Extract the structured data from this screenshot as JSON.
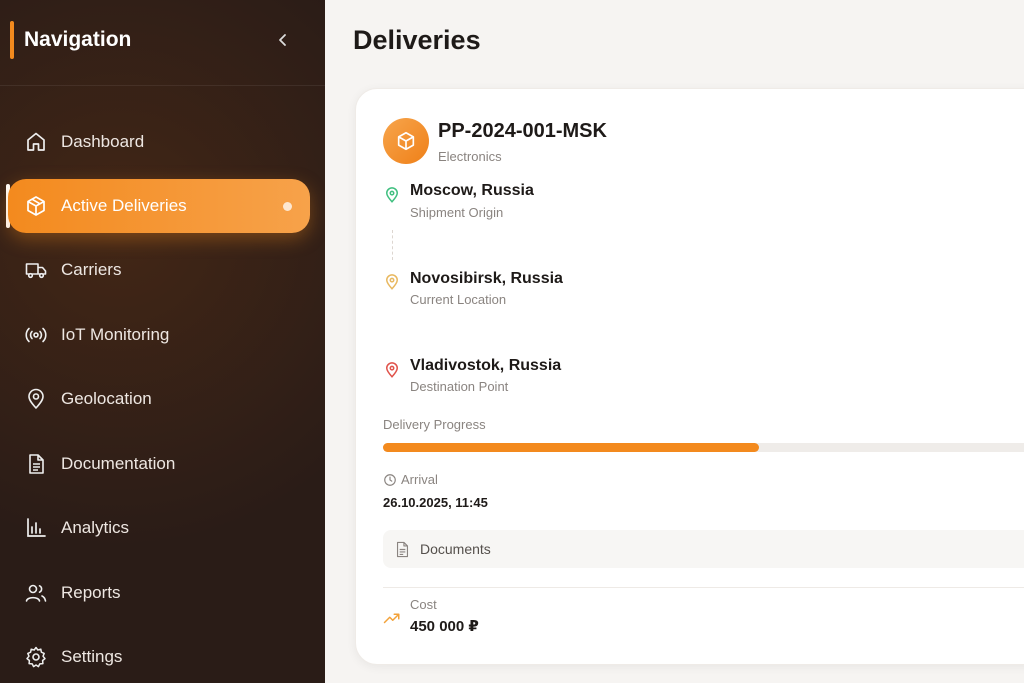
{
  "sidebar": {
    "title": "Navigation",
    "items": [
      {
        "label": "Dashboard",
        "icon": "home-icon"
      },
      {
        "label": "Active Deliveries",
        "icon": "package-icon",
        "active": true
      },
      {
        "label": "Carriers",
        "icon": "truck-icon"
      },
      {
        "label": "IoT Monitoring",
        "icon": "radio-signal-icon"
      },
      {
        "label": "Geolocation",
        "icon": "map-pin-icon"
      },
      {
        "label": "Documentation",
        "icon": "document-icon"
      },
      {
        "label": "Analytics",
        "icon": "bar-chart-icon"
      },
      {
        "label": "Reports",
        "icon": "users-icon"
      },
      {
        "label": "Settings",
        "icon": "gear-icon"
      }
    ]
  },
  "main": {
    "title": "Deliveries",
    "shipment": {
      "id": "PP-2024-001-MSK",
      "category": "Electronics",
      "origin": {
        "name": "Moscow, Russia",
        "sub": "Shipment Origin"
      },
      "current": {
        "name": "Novosibirsk, Russia",
        "sub": "Current Location"
      },
      "destination": {
        "name": "Vladivostok, Russia",
        "sub": "Destination Point"
      },
      "progress_label": "Delivery Progress",
      "progress_percent": 57,
      "arrival_label": "Arrival",
      "arrival_value": "26.10.2025, 11:45",
      "documents_label": "Documents",
      "cost_label": "Cost",
      "cost_value": "450 000 ₽"
    }
  },
  "colors": {
    "accent": "#f38a1e",
    "sidebar_bg": "#2a1c17",
    "origin_pin": "#3fbf7f",
    "current_pin": "#e8b860",
    "destination_pin": "#e0524a"
  }
}
